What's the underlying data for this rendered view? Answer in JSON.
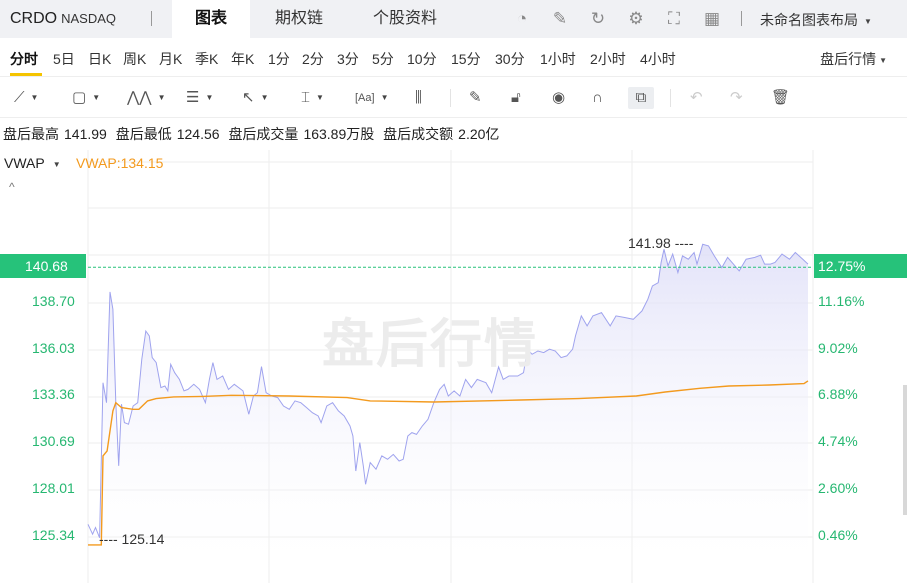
{
  "header": {
    "symbol": "CRDO",
    "exchange": "NASDAQ",
    "tabs": [
      "图表",
      "期权链",
      "个股资料"
    ],
    "active_tab": "图表",
    "layout_label": "未命名图表布局"
  },
  "periods": {
    "items": [
      "分时",
      "5日",
      "日K",
      "周K",
      "月K",
      "季K",
      "年K",
      "1分",
      "2分",
      "3分",
      "5分",
      "10分",
      "15分",
      "30分",
      "1小时",
      "2小时",
      "4小时"
    ],
    "active": "分时",
    "session_label": "盘后行情"
  },
  "toolbar": {
    "icons": [
      "trendline-icon",
      "rectangle-icon",
      "pattern-icon",
      "fib-icon",
      "arrow-icon",
      "measure-icon",
      "text-icon",
      "candle-icon",
      "pencil-icon",
      "lock-icon",
      "eye-icon",
      "magnet-icon",
      "link-icon",
      "undo-icon",
      "redo-icon",
      "trash-icon"
    ]
  },
  "info": {
    "high_label": "盘后最高",
    "high": "141.99",
    "low_label": "盘后最低",
    "low": "124.56",
    "vol_label": "盘后成交量",
    "vol": "163.89万股",
    "amt_label": "盘后成交额",
    "amt": "2.20亿"
  },
  "indicator": {
    "name": "VWAP",
    "value_label": "VWAP:134.15",
    "collapse": "^"
  },
  "watermark": "盘后行情",
  "colors": {
    "up": "#26b771",
    "price_line": "#9fa3ee",
    "vwap": "#f39a1e",
    "tag": "#26c27a"
  },
  "chart_data": {
    "type": "line",
    "current_price": "140.68",
    "current_pct": "12.75%",
    "max_marker": "141.98",
    "min_marker": "125.14",
    "y_left_ticks": [
      "138.70",
      "136.03",
      "133.36",
      "130.69",
      "128.01",
      "125.34"
    ],
    "y_right_ticks": [
      "11.16%",
      "9.02%",
      "6.88%",
      "4.74%",
      "2.60%",
      "0.46%"
    ],
    "ylim": [
      124.2,
      147
    ],
    "xlim": [
      0,
      1245
    ],
    "series": [
      {
        "name": "price",
        "points": [
          [
            0,
            126.01
          ],
          [
            8,
            125.44
          ],
          [
            13,
            125.82
          ],
          [
            20,
            125.24
          ],
          [
            26,
            134.09
          ],
          [
            32,
            132.95
          ],
          [
            38,
            139.27
          ],
          [
            43,
            138.28
          ],
          [
            48,
            132.95
          ],
          [
            53,
            129.34
          ],
          [
            58,
            132.86
          ],
          [
            63,
            131.81
          ],
          [
            70,
            131.72
          ],
          [
            78,
            132.76
          ],
          [
            86,
            132.95
          ],
          [
            93,
            135.43
          ],
          [
            100,
            137.04
          ],
          [
            106,
            136.76
          ],
          [
            111,
            135.52
          ],
          [
            118,
            135.24
          ],
          [
            126,
            133.81
          ],
          [
            133,
            133.9
          ],
          [
            138,
            133.62
          ],
          [
            143,
            135.14
          ],
          [
            150,
            134.66
          ],
          [
            158,
            134.28
          ],
          [
            166,
            133.62
          ],
          [
            173,
            133.71
          ],
          [
            183,
            134.0
          ],
          [
            193,
            133.71
          ],
          [
            203,
            132.95
          ],
          [
            210,
            134.28
          ],
          [
            216,
            135.24
          ],
          [
            223,
            134.28
          ],
          [
            233,
            134.47
          ],
          [
            243,
            133.71
          ],
          [
            253,
            134.0
          ],
          [
            268,
            133.62
          ],
          [
            278,
            132.29
          ],
          [
            286,
            133.33
          ],
          [
            293,
            133.52
          ],
          [
            300,
            135.01
          ],
          [
            308,
            133.52
          ],
          [
            318,
            133.33
          ],
          [
            328,
            133.24
          ],
          [
            338,
            132.76
          ],
          [
            348,
            132.57
          ],
          [
            358,
            133.05
          ],
          [
            368,
            132.95
          ],
          [
            378,
            132.67
          ],
          [
            388,
            132.38
          ],
          [
            398,
            132.19
          ],
          [
            403,
            131.81
          ],
          [
            413,
            132.76
          ],
          [
            423,
            132.95
          ],
          [
            433,
            132.48
          ],
          [
            443,
            132.19
          ],
          [
            453,
            131.62
          ],
          [
            458,
            131.05
          ],
          [
            463,
            129.05
          ],
          [
            470,
            130.67
          ],
          [
            476,
            129.34
          ],
          [
            480,
            128.29
          ],
          [
            488,
            129.53
          ],
          [
            498,
            129.15
          ],
          [
            508,
            129.91
          ],
          [
            518,
            129.72
          ],
          [
            528,
            130.0
          ],
          [
            538,
            129.62
          ],
          [
            545,
            129.72
          ],
          [
            553,
            131.05
          ],
          [
            560,
            131.24
          ],
          [
            568,
            131.14
          ],
          [
            578,
            131.62
          ],
          [
            588,
            132.0
          ],
          [
            598,
            132.95
          ],
          [
            608,
            133.71
          ],
          [
            616,
            134.0
          ],
          [
            623,
            133.33
          ],
          [
            633,
            133.62
          ],
          [
            643,
            133.33
          ],
          [
            653,
            134.28
          ],
          [
            663,
            133.81
          ],
          [
            673,
            134.28
          ],
          [
            688,
            134.09
          ],
          [
            698,
            133.52
          ],
          [
            710,
            134.99
          ],
          [
            718,
            134.28
          ],
          [
            728,
            134.47
          ],
          [
            743,
            134.47
          ],
          [
            753,
            134.66
          ],
          [
            760,
            136.0
          ],
          [
            768,
            135.71
          ],
          [
            778,
            135.9
          ],
          [
            788,
            135.81
          ],
          [
            798,
            136.0
          ],
          [
            808,
            135.9
          ],
          [
            818,
            135.52
          ],
          [
            828,
            135.62
          ],
          [
            838,
            136.0
          ],
          [
            843,
            136.76
          ],
          [
            853,
            137.9
          ],
          [
            863,
            137.33
          ],
          [
            873,
            137.9
          ],
          [
            888,
            138.09
          ],
          [
            903,
            137.33
          ],
          [
            913,
            137.9
          ],
          [
            928,
            137.81
          ],
          [
            943,
            137.71
          ],
          [
            958,
            138.19
          ],
          [
            968,
            138.85
          ],
          [
            976,
            139.61
          ],
          [
            986,
            139.8
          ],
          [
            991,
            140.95
          ],
          [
            996,
            141.71
          ],
          [
            1003,
            140.76
          ],
          [
            1011,
            141.43
          ],
          [
            1020,
            140.38
          ],
          [
            1028,
            141.33
          ],
          [
            1038,
            141.14
          ],
          [
            1048,
            141.52
          ],
          [
            1053,
            140.86
          ],
          [
            1063,
            141.99
          ],
          [
            1073,
            141.9
          ],
          [
            1083,
            141.33
          ],
          [
            1096,
            140.66
          ],
          [
            1106,
            141.24
          ],
          [
            1116,
            140.86
          ],
          [
            1126,
            140.47
          ],
          [
            1138,
            141.14
          ],
          [
            1153,
            141.24
          ],
          [
            1163,
            141.37
          ],
          [
            1170,
            140.86
          ],
          [
            1180,
            140.86
          ],
          [
            1188,
            140.95
          ],
          [
            1200,
            141.43
          ],
          [
            1213,
            141.14
          ],
          [
            1223,
            141.52
          ],
          [
            1236,
            141.14
          ],
          [
            1245,
            140.86
          ]
        ]
      },
      {
        "name": "VWAP",
        "points": [
          [
            0,
            124.83
          ],
          [
            23,
            124.83
          ],
          [
            26,
            129.91
          ],
          [
            33,
            130.19
          ],
          [
            43,
            132.48
          ],
          [
            48,
            132.95
          ],
          [
            58,
            132.67
          ],
          [
            78,
            132.57
          ],
          [
            88,
            132.57
          ],
          [
            103,
            133.05
          ],
          [
            118,
            133.18
          ],
          [
            148,
            133.28
          ],
          [
            198,
            133.31
          ],
          [
            248,
            133.37
          ],
          [
            348,
            133.33
          ],
          [
            448,
            133.24
          ],
          [
            488,
            133.05
          ],
          [
            598,
            132.99
          ],
          [
            748,
            133.1
          ],
          [
            848,
            133.18
          ],
          [
            948,
            133.33
          ],
          [
            998,
            133.56
          ],
          [
            1058,
            133.77
          ],
          [
            1108,
            133.9
          ],
          [
            1178,
            133.96
          ],
          [
            1238,
            134.04
          ],
          [
            1245,
            134.19
          ]
        ]
      }
    ]
  }
}
